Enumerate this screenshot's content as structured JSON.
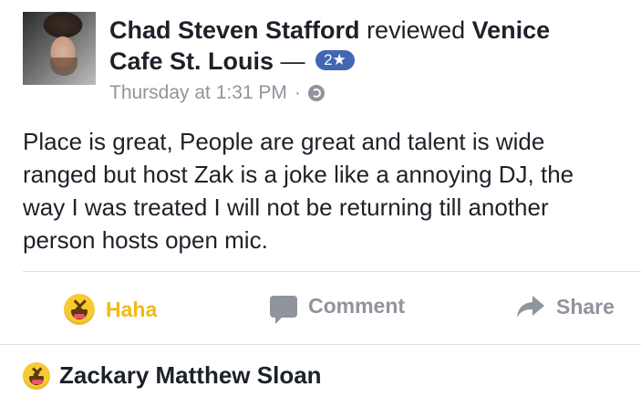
{
  "post": {
    "author": "Chad Steven Stafford",
    "action_text": "reviewed",
    "page_name_line1": "Venice",
    "page_name_line2": "Cafe St. Louis",
    "dash": "—",
    "rating_badge": "2★",
    "timestamp": "Thursday at 1:31 PM",
    "separator": "·",
    "privacy_icon": "globe-icon",
    "text_lines": [
      "Place is great, People are great and talent is wide",
      "ranged but host Zak is a joke like a annoying DJ, the",
      "way I was treated I will not be returning till another",
      "person hosts open mic."
    ]
  },
  "actions": {
    "haha_label": "Haha",
    "comment_label": "Comment",
    "share_label": "Share",
    "haha_color": "#f0ba15",
    "inactive_color": "#90949c"
  },
  "reactor": {
    "name": "Zackary Matthew Sloan",
    "reaction_icon": "haha-emoji-icon"
  }
}
